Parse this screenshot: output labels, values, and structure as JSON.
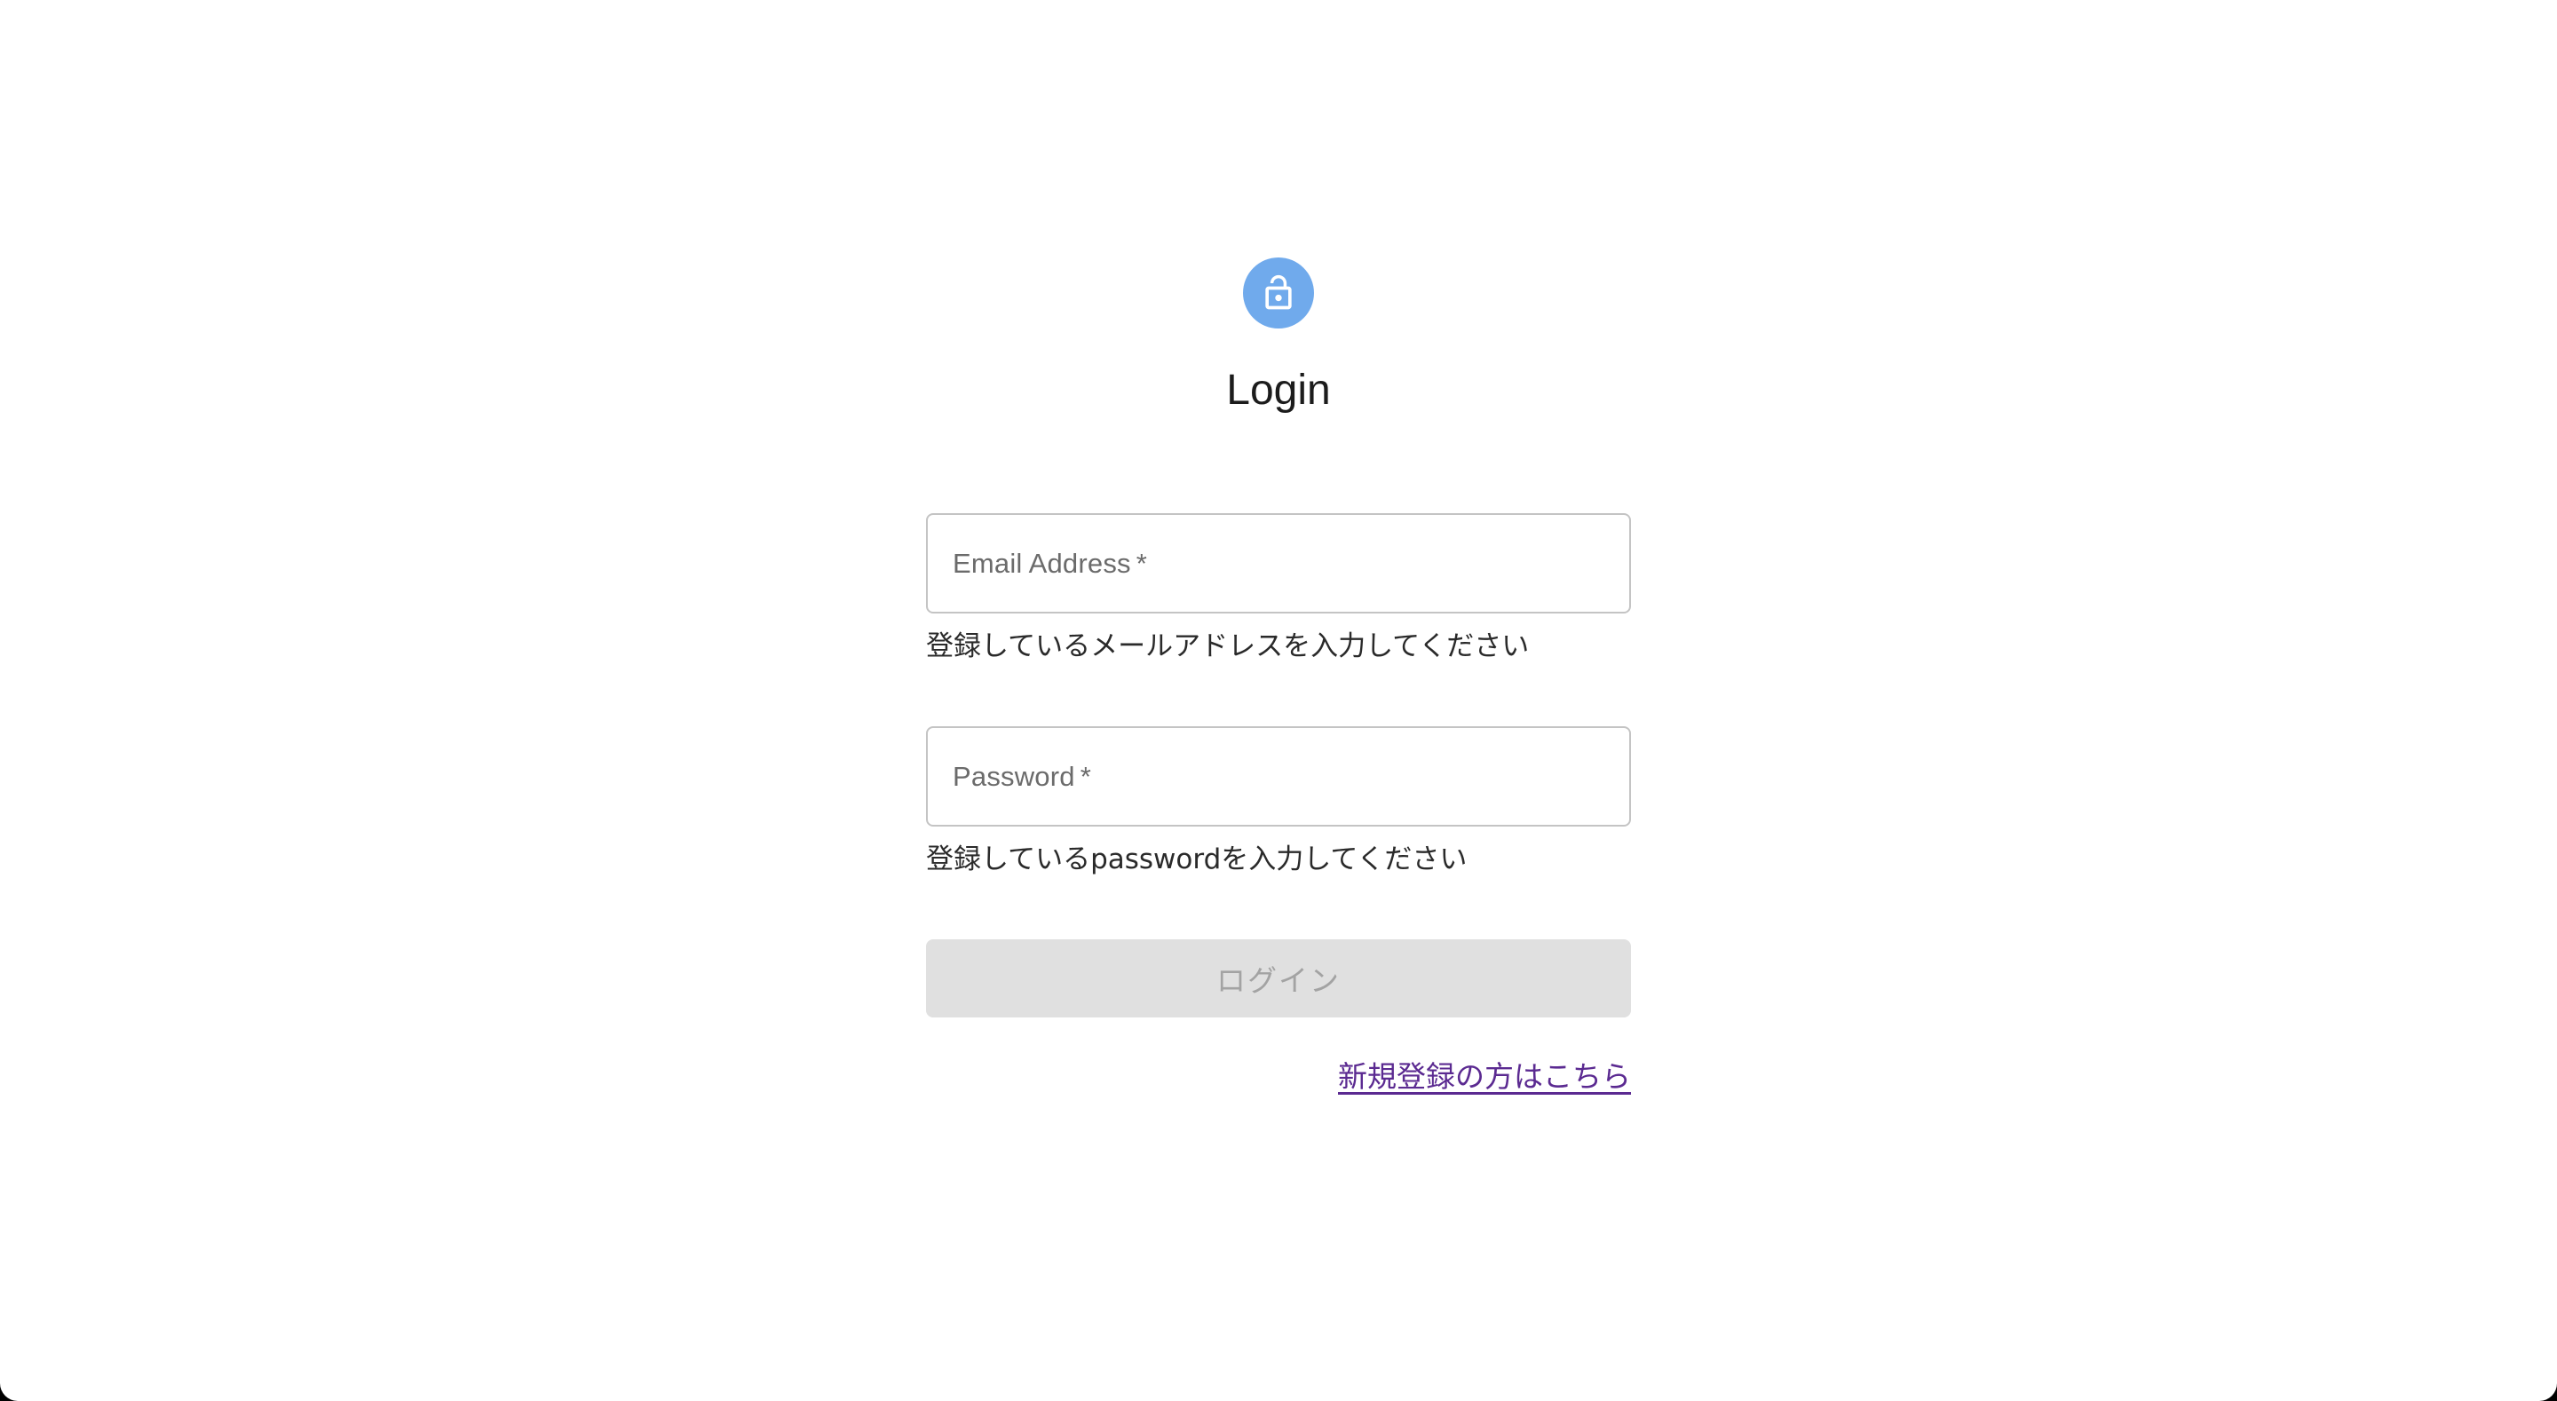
{
  "login": {
    "title": "Login",
    "lock_icon": "lock-open-icon",
    "accent_color": "#70aaec",
    "email": {
      "label": "Email Address",
      "required_mark": "*",
      "value": "",
      "helper": "登録しているメールアドレスを入力してください"
    },
    "password": {
      "label": "Password",
      "required_mark": "*",
      "value": "",
      "helper": "登録しているpasswordを入力してください"
    },
    "submit_label": "ログイン",
    "signup_link": "新規登録の方はこちら"
  }
}
